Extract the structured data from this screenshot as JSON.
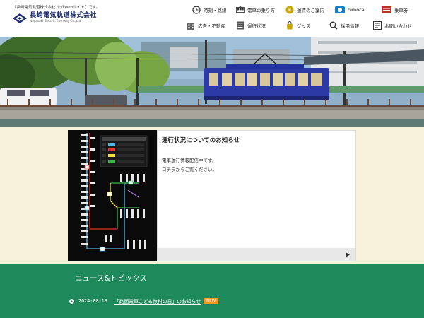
{
  "header": {
    "tagline": "【長崎電気軌道株式会社 公式Webサイト】です。",
    "logo_jp": "長崎電気軌道株式会社",
    "logo_en": "Nagasaki Electric Tramway Co.,Ltd."
  },
  "nav": {
    "row1": [
      {
        "label": "時刻・路線",
        "icon": "clock-icon"
      },
      {
        "label": "電車の乗り方",
        "icon": "tram-icon"
      },
      {
        "label": "運賃のご案内",
        "icon": "yen-coin-icon"
      },
      {
        "label": "nimoca",
        "icon": "nimoca-card-icon"
      },
      {
        "label": "乗車券",
        "icon": "ticket-icon"
      }
    ],
    "row2": [
      {
        "label": "広告・不動産",
        "icon": "building-icon"
      },
      {
        "label": "運行状況",
        "icon": "status-icon"
      },
      {
        "label": "グッズ",
        "icon": "goods-bag-icon"
      },
      {
        "label": "採用情報",
        "icon": "recruit-icon"
      },
      {
        "label": "お問い合わせ",
        "icon": "contact-form-icon"
      }
    ]
  },
  "notice": {
    "title": "運行状況についてのお知らせ",
    "line1": "電車運行情報配信中です。",
    "line2": "コチラからご覧ください。"
  },
  "news": {
    "heading": "ニュース&トピックス",
    "items": [
      {
        "date": "2024-08-19",
        "title": "「路面電車こども無料の日」のお知らせ",
        "badge": "NEW"
      }
    ]
  },
  "colors": {
    "brand_navy": "#1c2a6b",
    "news_green": "#1e8a5c",
    "middle_bg": "#f7f1da",
    "badge_orange": "#f39a1e",
    "tram_blue": "#2c3aa5"
  }
}
